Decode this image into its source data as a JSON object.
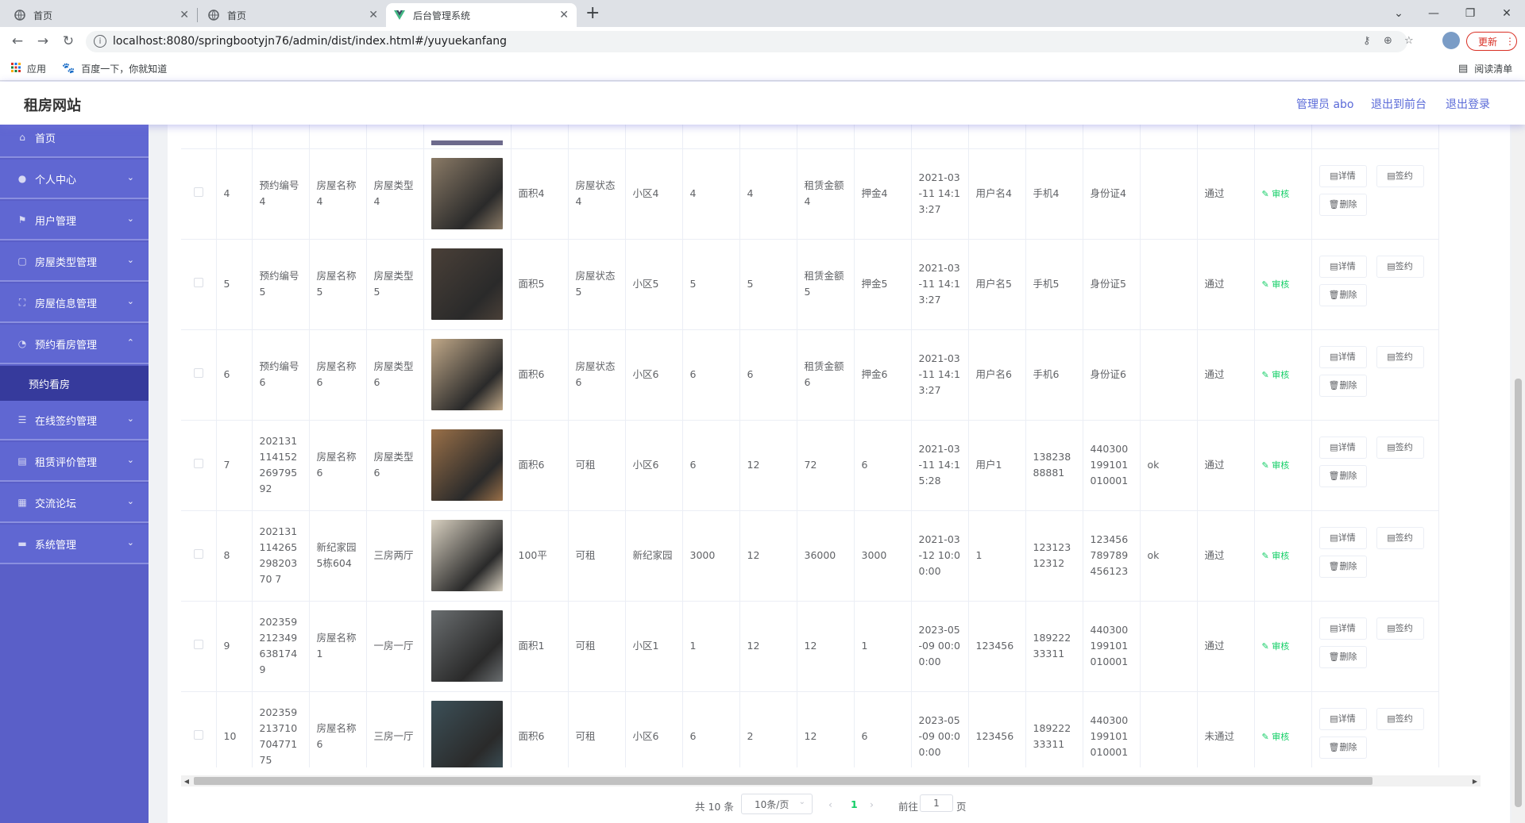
{
  "browser": {
    "tabs": [
      {
        "title": "首页",
        "icon": "globe-icon"
      },
      {
        "title": "首页",
        "icon": "globe-icon"
      },
      {
        "title": "后台管理系统",
        "icon": "vue-logo-icon"
      }
    ],
    "url": "localhost:8080/springbootyjn76/admin/dist/index.html#/yuyuekanfang",
    "update_label": "更新",
    "bookmarks": [
      {
        "label": "应用",
        "icon": "apps-grid-icon"
      },
      {
        "label": "百度一下，你就知道",
        "icon": "baidu-paw-icon"
      }
    ],
    "reading_list": "阅读清单"
  },
  "header": {
    "site_title": "租房网站",
    "admin_label": "管理员 abo",
    "front_link": "退出到前台",
    "logout_link": "退出登录"
  },
  "sidebar": {
    "items": [
      {
        "label": "首页",
        "icon": "home-icon",
        "expandable": false
      },
      {
        "label": "个人中心",
        "icon": "user-icon",
        "expandable": true
      },
      {
        "label": "用户管理",
        "icon": "flag-icon",
        "expandable": true
      },
      {
        "label": "房屋类型管理",
        "icon": "frame-icon",
        "expandable": true
      },
      {
        "label": "房屋信息管理",
        "icon": "full-screen-icon",
        "expandable": true
      },
      {
        "label": "预约看房管理",
        "icon": "compass-icon",
        "expandable": true,
        "open": true
      },
      {
        "label": "在线签约管理",
        "icon": "sort-icon",
        "expandable": true
      },
      {
        "label": "租赁评价管理",
        "icon": "list-icon",
        "expandable": true
      },
      {
        "label": "交流论坛",
        "icon": "document-icon",
        "expandable": true
      },
      {
        "label": "系统管理",
        "icon": "message-icon",
        "expandable": true
      }
    ],
    "active_sub": "预约看房"
  },
  "table": {
    "thumb_colors": [
      "#6d6a8c",
      "#8a7a66",
      "#4a4038",
      "#c0a888",
      "#9a7048",
      "#d8d0c0",
      "#6a6e70",
      "#3c5058"
    ],
    "rows": [
      {
        "no": "4",
        "yuyue": "预约编号4",
        "name": "房屋名称4",
        "type": "房屋类型4",
        "area": "面积4",
        "status": "房屋状态4",
        "xiaoqu": "小区4",
        "a": "4",
        "b": "4",
        "rent": "租赁金额4",
        "deposit": "押金4",
        "time": "2021-03-11 14:13:27",
        "user": "用户名4",
        "phone": "手机4",
        "idcard": "身份证4",
        "remark": "",
        "review": "通过"
      },
      {
        "no": "5",
        "yuyue": "预约编号5",
        "name": "房屋名称5",
        "type": "房屋类型5",
        "area": "面积5",
        "status": "房屋状态5",
        "xiaoqu": "小区5",
        "a": "5",
        "b": "5",
        "rent": "租赁金额5",
        "deposit": "押金5",
        "time": "2021-03-11 14:13:27",
        "user": "用户名5",
        "phone": "手机5",
        "idcard": "身份证5",
        "remark": "",
        "review": "通过"
      },
      {
        "no": "6",
        "yuyue": "预约编号6",
        "name": "房屋名称6",
        "type": "房屋类型6",
        "area": "面积6",
        "status": "房屋状态6",
        "xiaoqu": "小区6",
        "a": "6",
        "b": "6",
        "rent": "租赁金额6",
        "deposit": "押金6",
        "time": "2021-03-11 14:13:27",
        "user": "用户名6",
        "phone": "手机6",
        "idcard": "身份证6",
        "remark": "",
        "review": "通过"
      },
      {
        "no": "7",
        "yuyue": "20213111415226979592",
        "name": "房屋名称6",
        "type": "房屋类型6",
        "area": "面积6",
        "status": "可租",
        "xiaoqu": "小区6",
        "a": "6",
        "b": "12",
        "rent": "72",
        "deposit": "6",
        "time": "2021-03-11 14:15:28",
        "user": "用户1",
        "phone": "13823888881",
        "idcard": "440300199101010001",
        "remark": "ok",
        "review": "通过"
      },
      {
        "no": "8",
        "yuyue": "20213111426529820370 7",
        "name": "新纪家园5栋604",
        "type": "三房两厅",
        "area": "100平",
        "status": "可租",
        "xiaoqu": "新纪家园",
        "a": "3000",
        "b": "12",
        "rent": "36000",
        "deposit": "3000",
        "time": "2021-03-12 10:00:00",
        "user": "1",
        "phone": "12312312312",
        "idcard": "123456789789456123",
        "remark": "ok",
        "review": "通过"
      },
      {
        "no": "9",
        "yuyue": "2023592123496381749",
        "name": "房屋名称1",
        "type": "一房一厅",
        "area": "面积1",
        "status": "可租",
        "xiaoqu": "小区1",
        "a": "1",
        "b": "12",
        "rent": "12",
        "deposit": "1",
        "time": "2023-05-09 00:00:00",
        "user": "123456",
        "phone": "18922233311",
        "idcard": "440300199101010001",
        "remark": "",
        "review": "通过"
      },
      {
        "no": "10",
        "yuyue": "20235921371070477175",
        "name": "房屋名称6",
        "type": "三房一厅",
        "area": "面积6",
        "status": "可租",
        "xiaoqu": "小区6",
        "a": "6",
        "b": "2",
        "rent": "12",
        "deposit": "6",
        "time": "2023-05-09 00:00:00",
        "user": "123456",
        "phone": "18922233311",
        "idcard": "440300199101010001",
        "remark": "",
        "review": "未通过"
      }
    ],
    "audit_label": "审核",
    "detail_label": "详情",
    "sign_label": "签约",
    "delete_label": "删除"
  },
  "pagination": {
    "total": "共 10 条",
    "page_size": "10条/页",
    "current": "1",
    "goto_prefix": "前往",
    "goto_value": "1",
    "goto_suffix": "页"
  }
}
